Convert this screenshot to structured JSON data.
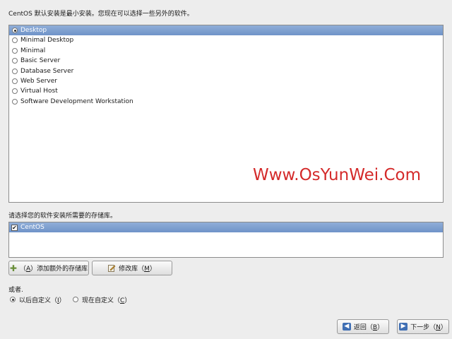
{
  "intro_text": "CentOS 默认安装是最小安装。您现在可以选择一些另外的软件。",
  "install_types": [
    {
      "label": "Desktop",
      "selected": true
    },
    {
      "label": "Minimal Desktop",
      "selected": false
    },
    {
      "label": "Minimal",
      "selected": false
    },
    {
      "label": "Basic Server",
      "selected": false
    },
    {
      "label": "Database Server",
      "selected": false
    },
    {
      "label": "Web Server",
      "selected": false
    },
    {
      "label": "Virtual Host",
      "selected": false
    },
    {
      "label": "Software Development Workstation",
      "selected": false
    }
  ],
  "watermark": "Www.OsYunWei.Com",
  "repo_section_label": "请选择您的软件安装所需要的存储库。",
  "repos": [
    {
      "label": "CentOS",
      "checked": true
    }
  ],
  "buttons": {
    "add_repo": {
      "prefix": "（",
      "mnemonic": "A",
      "suffix": "）添加额外的存储库"
    },
    "modify_repo": {
      "prefix": "修改库（",
      "mnemonic": "M",
      "suffix": "）"
    },
    "back": {
      "prefix": "返回（",
      "mnemonic": "B",
      "suffix": "）"
    },
    "next": {
      "prefix": "下一步（",
      "mnemonic": "N",
      "suffix": "）"
    }
  },
  "or_label": "或者.",
  "customize_options": {
    "later": {
      "prefix": "以后自定义（",
      "mnemonic": "I",
      "suffix": "）",
      "selected": true
    },
    "now": {
      "prefix": "现在自定义（",
      "mnemonic": "C",
      "suffix": "）",
      "selected": false
    }
  },
  "icons": {
    "add_repo": "plus-icon",
    "modify_repo": "pencil-icon",
    "back": "back-arrow-icon",
    "next": "forward-arrow-icon"
  },
  "colors": {
    "selection": "#7b9bcc",
    "watermark": "#d42a2a",
    "background": "#ededed"
  }
}
